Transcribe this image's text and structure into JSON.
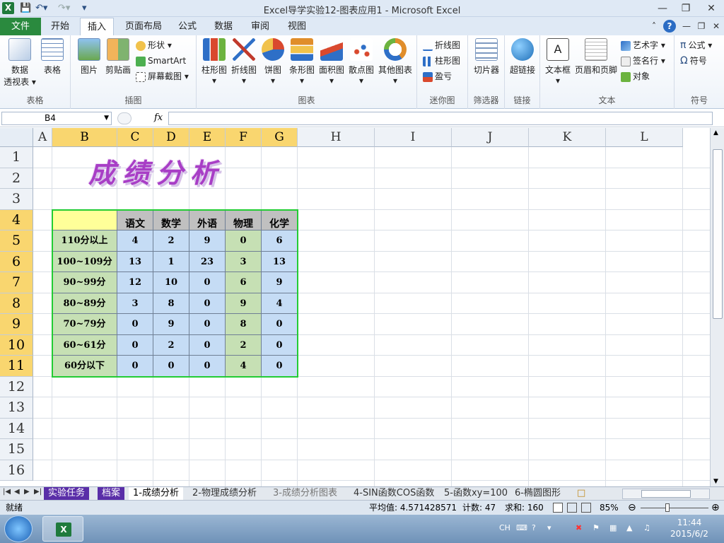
{
  "window": {
    "title": "Excel导学实验12-图表应用1 - Microsoft Excel",
    "app_icon": "X",
    "controls": [
      "—",
      "❐",
      "✕"
    ]
  },
  "ribbon_tabs": {
    "file": "文件",
    "tabs": [
      "开始",
      "插入",
      "页面布局",
      "公式",
      "数据",
      "审阅",
      "视图"
    ],
    "active": "插入"
  },
  "ribbon": {
    "groups": {
      "tables": {
        "label": "表格",
        "pivot": "数据\n透视表",
        "pivot_l1": "数据",
        "pivot_l2": "透视表",
        "table": "表格"
      },
      "illustrations": {
        "label": "插图",
        "picture": "图片",
        "clipart": "剪贴画",
        "shapes": "形状",
        "smartart": "SmartArt",
        "screenshot": "屏幕截图"
      },
      "charts": {
        "label": "图表",
        "items": [
          "柱形图",
          "折线图",
          "饼图",
          "条形图",
          "面积图",
          "散点图",
          "其他图表"
        ]
      },
      "sparklines": {
        "label": "迷你图",
        "line": "折线图",
        "column": "柱形图",
        "winloss": "盈亏"
      },
      "filter": {
        "label": "筛选器",
        "slicer": "切片器"
      },
      "links": {
        "label": "链接",
        "hyperlink": "超链接"
      },
      "text": {
        "label": "文本",
        "textbox": "文本框",
        "header_footer": "页眉和页脚",
        "wordart": "艺术字",
        "signature": "签名行",
        "object": "对象"
      },
      "symbols": {
        "label": "符号",
        "equation": "公式",
        "symbol": "符号"
      }
    }
  },
  "formula_bar": {
    "name_box": "B4",
    "fx": "fx",
    "formula": ""
  },
  "columns": [
    "A",
    "B",
    "C",
    "D",
    "E",
    "F",
    "G",
    "H",
    "I",
    "J",
    "K",
    "L"
  ],
  "rows": [
    "1",
    "2",
    "3",
    "4",
    "5",
    "6",
    "7",
    "8",
    "9",
    "10",
    "11",
    "12",
    "13",
    "14",
    "15",
    "16"
  ],
  "sheet": {
    "title_art": "成绩分析",
    "table": {
      "headers": [
        "",
        "语文",
        "数学",
        "外语",
        "物理",
        "化学"
      ],
      "rows": [
        [
          "110分以上",
          "4",
          "2",
          "9",
          "0",
          "6"
        ],
        [
          "100~109分",
          "13",
          "1",
          "23",
          "3",
          "13"
        ],
        [
          "90~99分",
          "12",
          "10",
          "0",
          "6",
          "9"
        ],
        [
          "80~89分",
          "3",
          "8",
          "0",
          "9",
          "4"
        ],
        [
          "70~79分",
          "0",
          "9",
          "0",
          "8",
          "0"
        ],
        [
          "60~61分",
          "0",
          "2",
          "0",
          "2",
          "0"
        ],
        [
          "60分以下",
          "0",
          "0",
          "0",
          "4",
          "0"
        ]
      ]
    },
    "colors": {
      "header_blank": "#ffff99",
      "header_subject": "#c0c0c0",
      "row_label": "#c6e0b4",
      "data": "#c5dcf5",
      "data_physics": "#c6e0b4",
      "selection": "#22cc33"
    }
  },
  "sheet_tabs": {
    "items": [
      "实验任务",
      "档案",
      "1-成绩分析",
      "2-物理成绩分析",
      "3-成绩分析图表",
      "4-SIN函数COS函数",
      "5-函数xy=100",
      "6-椭圆图形"
    ],
    "active": "1-成绩分析"
  },
  "status": {
    "ready": "就绪",
    "average": "平均值: 4.571428571",
    "count": "计数: 47",
    "sum": "求和: 160",
    "zoom": "85%"
  },
  "taskbar": {
    "lang": "CH",
    "time": "11:44",
    "date": "2015/6/2"
  }
}
